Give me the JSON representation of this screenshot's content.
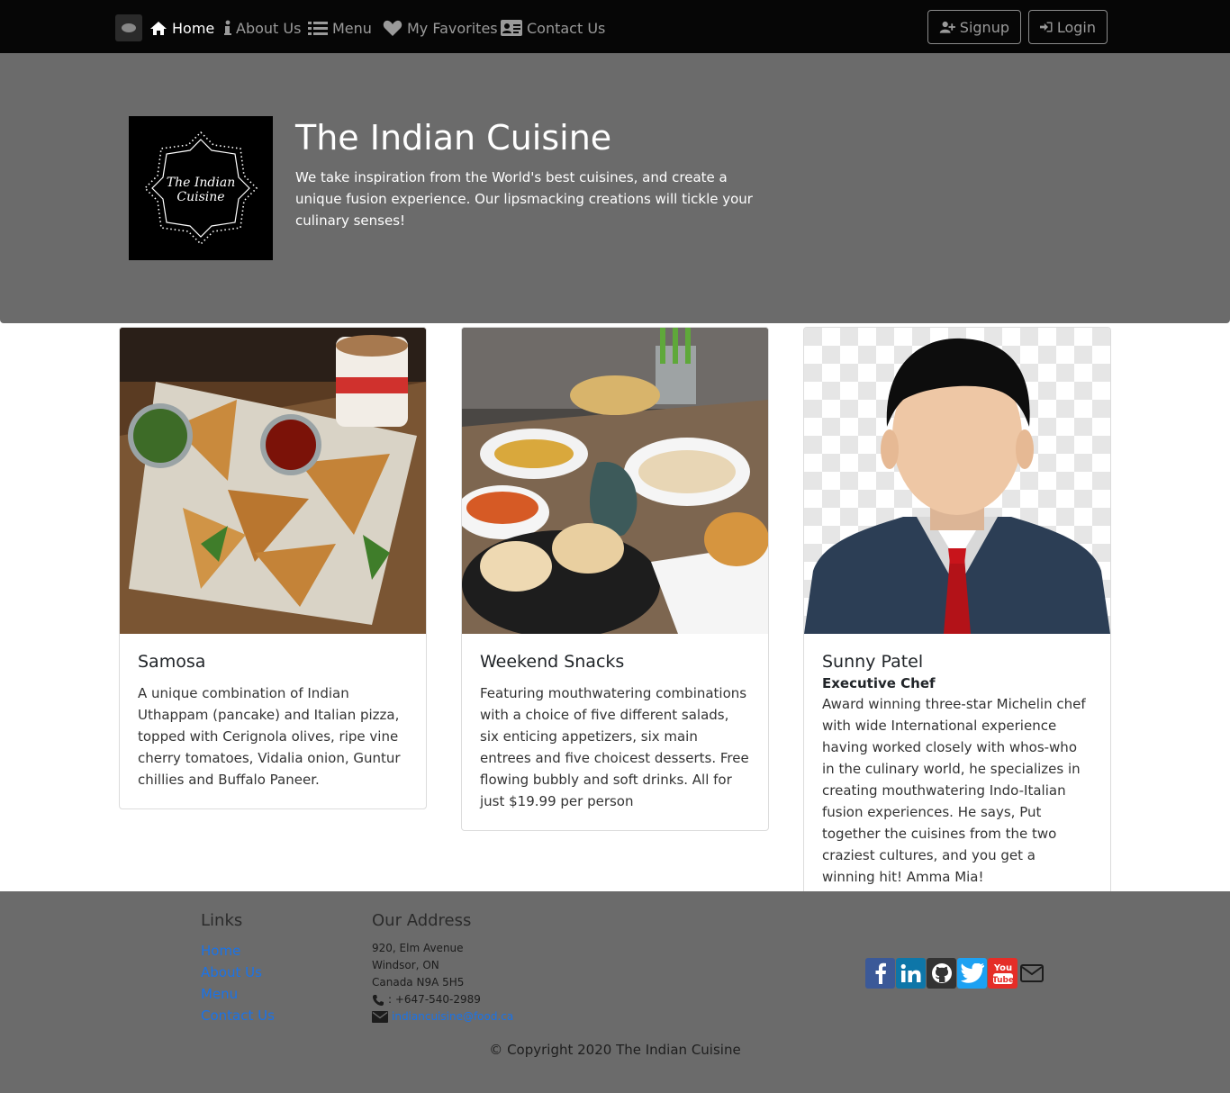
{
  "nav": {
    "items": [
      {
        "label": "Home",
        "icon": "home-icon"
      },
      {
        "label": "About Us",
        "icon": "info-icon"
      },
      {
        "label": "Menu",
        "icon": "list-icon"
      },
      {
        "label": "My Favorites",
        "icon": "heart-icon"
      },
      {
        "label": "Contact Us",
        "icon": "address-card-icon"
      }
    ],
    "signup_label": "Signup",
    "login_label": "Login",
    "active_index": 0
  },
  "hero": {
    "logo_text_line1": "The Indian",
    "logo_text_line2": "Cuisine",
    "title": "The Indian Cuisine",
    "description": "We take inspiration from the World's best cuisines, and create a unique fusion experience. Our lipsmacking creations will tickle your culinary senses!"
  },
  "cards": [
    {
      "title": "Samosa",
      "text": "A unique combination of Indian Uthappam (pancake) and Italian pizza, topped with Cerignola olives, ripe vine cherry tomatoes, Vidalia onion, Guntur chillies and Buffalo Paneer."
    },
    {
      "title": "Weekend Snacks",
      "text": "Featuring mouthwatering combinations with a choice of five different salads, six enticing appetizers, six main entrees and five choicest desserts. Free flowing bubbly and soft drinks. All for just $19.99 per person"
    },
    {
      "title": "Sunny Patel",
      "subtitle": "Executive Chef",
      "text": "Award winning three-star Michelin chef with wide International experience having worked closely with whos-who in the culinary world, he specializes in creating mouthwatering Indo-Italian fusion experiences. He says, Put together the cuisines from the two craziest cultures, and you get a winning hit! Amma Mia!"
    }
  ],
  "footer": {
    "links_heading": "Links",
    "links": [
      "Home",
      "About Us",
      "Menu",
      "Contact Us"
    ],
    "address_heading": "Our Address",
    "address_lines": [
      "920, Elm Avenue",
      "Windsor, ON",
      "Canada N9A 5H5"
    ],
    "phone": ": +647-540-2989",
    "email": "indiancuisine@food.ca",
    "socials": [
      "facebook-icon",
      "linkedin-icon",
      "github-icon",
      "twitter-icon",
      "youtube-icon",
      "envelope-icon"
    ],
    "copyright": "© Copyright 2020 The Indian Cuisine"
  },
  "colors": {
    "navbar_bg": "#060606",
    "hero_bg": "#6b6b6b",
    "link_blue": "#1a73e8",
    "facebook": "#3b5998",
    "linkedin": "#0e76a8",
    "twitter": "#1da1f2",
    "youtube": "#e52d27"
  }
}
